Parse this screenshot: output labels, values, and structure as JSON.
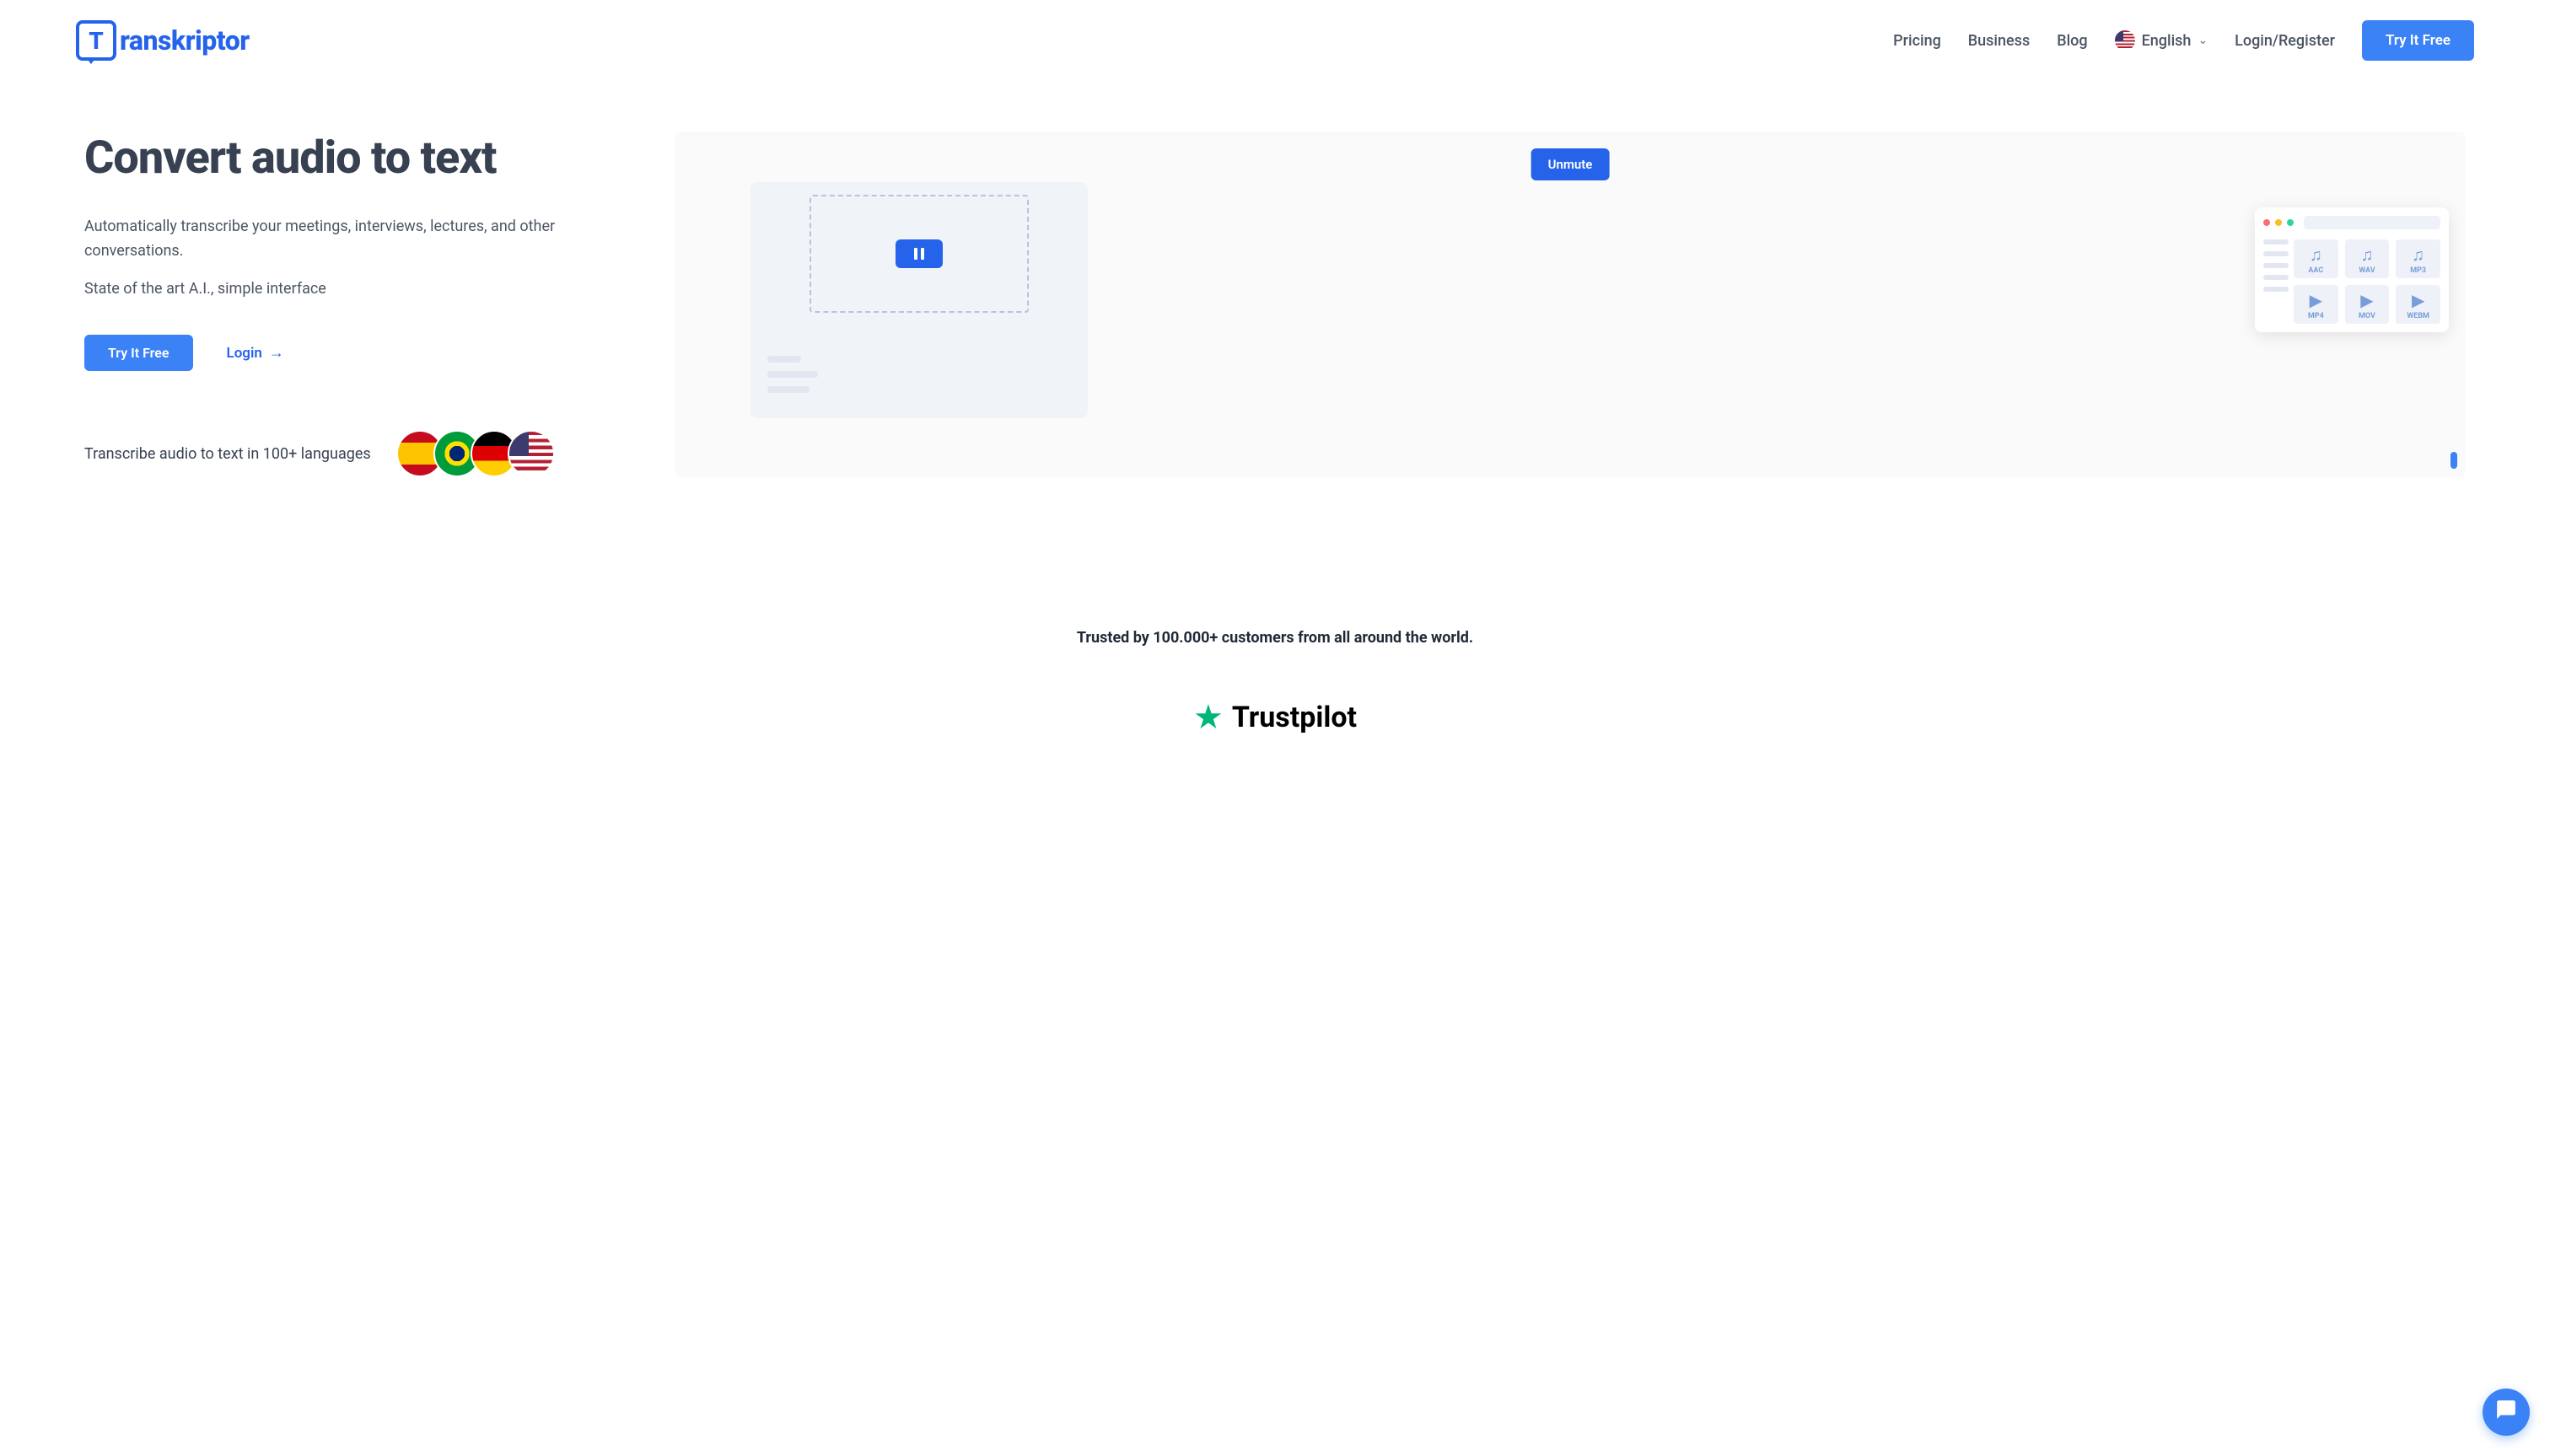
{
  "header": {
    "logo_text": "ranskriptor",
    "nav": {
      "pricing": "Pricing",
      "business": "Business",
      "blog": "Blog",
      "login_register": "Login/Register"
    },
    "language": "English",
    "cta": "Try It Free"
  },
  "hero": {
    "title": "Convert audio to text",
    "desc1": "Automatically transcribe your meetings, interviews, lectures, and other conversations.",
    "desc2": "State of the art A.I., simple interface",
    "try_free": "Try It Free",
    "login": "Login",
    "lang_text": "Transcribe audio to text in 100+ languages",
    "unmute": "Unmute"
  },
  "files": [
    {
      "icon": "♫",
      "label": "AAC"
    },
    {
      "icon": "♫",
      "label": "WAV"
    },
    {
      "icon": "♫",
      "label": "MP3"
    },
    {
      "icon": "▶",
      "label": "MP4"
    },
    {
      "icon": "▶",
      "label": "MOV"
    },
    {
      "icon": "▶",
      "label": "WEBM"
    }
  ],
  "trust": {
    "headline": "Trusted by 100.000+ customers from all around the world.",
    "brand": "Trustpilot"
  }
}
